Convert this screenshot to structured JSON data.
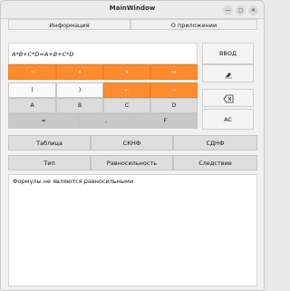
{
  "window": {
    "title": "MainWindow",
    "min": "—",
    "max": "◻",
    "close": "✕"
  },
  "menu": {
    "info": "Информация",
    "about": "О приложении"
  },
  "formula": {
    "value": "A*B+C*D=A+B+C*D"
  },
  "keys": {
    "row1": [
      "¬",
      "∧",
      "∨",
      "↔"
    ],
    "row2": [
      "(",
      ")",
      "←",
      "→"
    ],
    "row3": [
      "A",
      "B",
      "C",
      "D"
    ],
    "row4": [
      "=",
      ",",
      "F"
    ]
  },
  "side": {
    "enter": "ВВОД",
    "clear_all": "AC"
  },
  "actions1": {
    "table": "Таблица",
    "sknf": "СКНФ",
    "sdnf": "СДНФ"
  },
  "actions2": {
    "type": "Тип",
    "equivalence": "Равносильность",
    "consequence": "Следствие"
  },
  "output": {
    "text": "Формулы не являются равносильными"
  },
  "colors": {
    "accent": "#fe8c2e",
    "background": "#f0f0f0"
  }
}
